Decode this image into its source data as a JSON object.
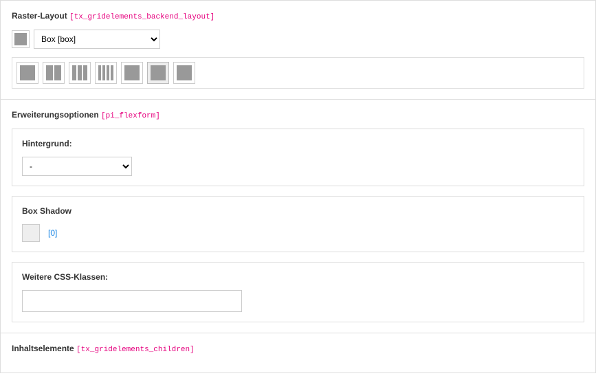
{
  "raster": {
    "title": "Raster-Layout",
    "code": "[tx_gridelements_backend_layout]",
    "selected": "Box [box]",
    "options": [
      "Box [box]"
    ],
    "layouts_count": 7,
    "selected_index": 5
  },
  "ext": {
    "title": "Erweiterungsoptionen",
    "code": "[pi_flexform]",
    "hintergrund": {
      "label": "Hintergrund:",
      "value": "-",
      "options": [
        "-"
      ]
    },
    "boxshadow": {
      "label": "Box Shadow",
      "value": "[0]"
    },
    "css": {
      "label": "Weitere CSS-Klassen:",
      "value": ""
    }
  },
  "inhalt": {
    "title": "Inhaltselemente",
    "code": "[tx_gridelements_children]"
  }
}
